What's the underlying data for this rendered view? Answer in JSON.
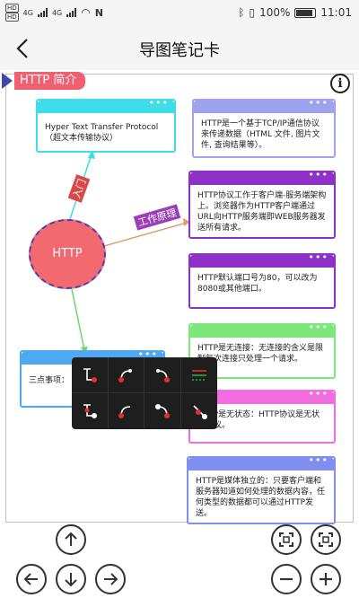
{
  "status_bar": {
    "sim": [
      "4G",
      "4G"
    ],
    "battery_percent": "100%",
    "time": "11:01"
  },
  "app_bar": {
    "title": "导图笔记卡"
  },
  "section": {
    "label": "HTTP 简介"
  },
  "center": {
    "label": "HTTP"
  },
  "edges": {
    "intro": "入门",
    "principle": "工作原理"
  },
  "nodes": [
    {
      "text": "Hyper Text Transfer Protocol（超文本传输协议）",
      "color": "#3fdcea"
    },
    {
      "text": "HTTP是一个基于TCP/IP通信协议来传递数据（HTML 文件, 图片文件, 查询结果等）。",
      "color": "#9ea3ee"
    },
    {
      "text": "HTTP协议工作于客户端-服务端架构上。浏览器作为HTTP客户端通过URL向HTTP服务端即WEB服务器发送所有请求。",
      "color": "#8e31c9"
    },
    {
      "text": "HTTP默认端口号为80，可以改为8080或其他端口。",
      "color": "#8e31c9"
    },
    {
      "text": "HTTP是无连接：无连接的含义是限制每次连接只处理一个请求。",
      "color": "#7ce87c"
    },
    {
      "text": "HTTP是无状态：HTTP协议是无状态协议。",
      "color": "#f26ee0"
    },
    {
      "text": "HTTP是媒体独立的：只要客户端和服务器知道如何处理的数据内容，任何类型的数据都可以通过HTTP发送。",
      "color": "#7f8ff0"
    },
    {
      "text": "三点事项：",
      "color": "#4ea9f2"
    }
  ],
  "node_dots": "•••",
  "icons": {
    "back": "arrow-left-icon",
    "info": "info-icon"
  },
  "info_glyph": "i",
  "colors": {
    "tag_bg": "#f06070",
    "tag_arrow": "#3b4aa8",
    "center_fill": "#f26a6f",
    "center_border": "#4a3fb8",
    "edge_intro": "#d94747",
    "edge_principle": "#9b3fb8"
  }
}
